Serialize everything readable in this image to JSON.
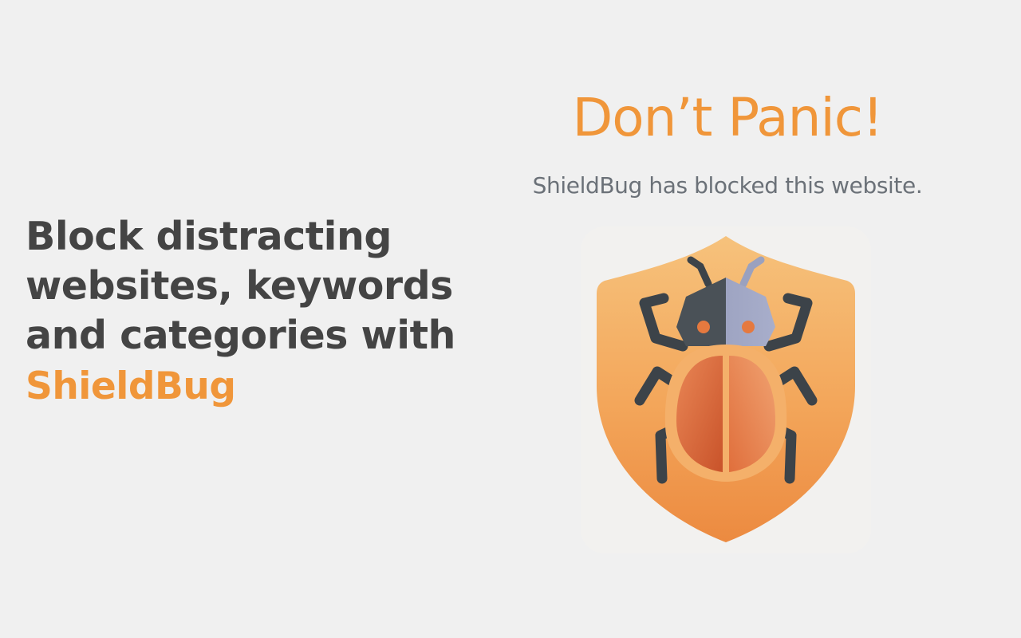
{
  "promo": {
    "tagline_lines": [
      "Block distracting",
      "websites, keywords",
      "and categories with"
    ],
    "brand": "ShieldBug"
  },
  "block_page": {
    "headline": "Don’t Panic!",
    "message": "ShieldBug has blocked this website."
  },
  "logo": {
    "icon": "shieldbug-logo-icon",
    "description_colors": {
      "shield_top": "#f6c27c",
      "shield_bottom": "#ec8a40",
      "bug_body": "#e3743d",
      "bug_dark": "#3c4349"
    }
  },
  "colors": {
    "accent": "#f0963a",
    "heading_text": "#444444",
    "muted_text": "#6b7178",
    "background": "#f0f0f0"
  }
}
